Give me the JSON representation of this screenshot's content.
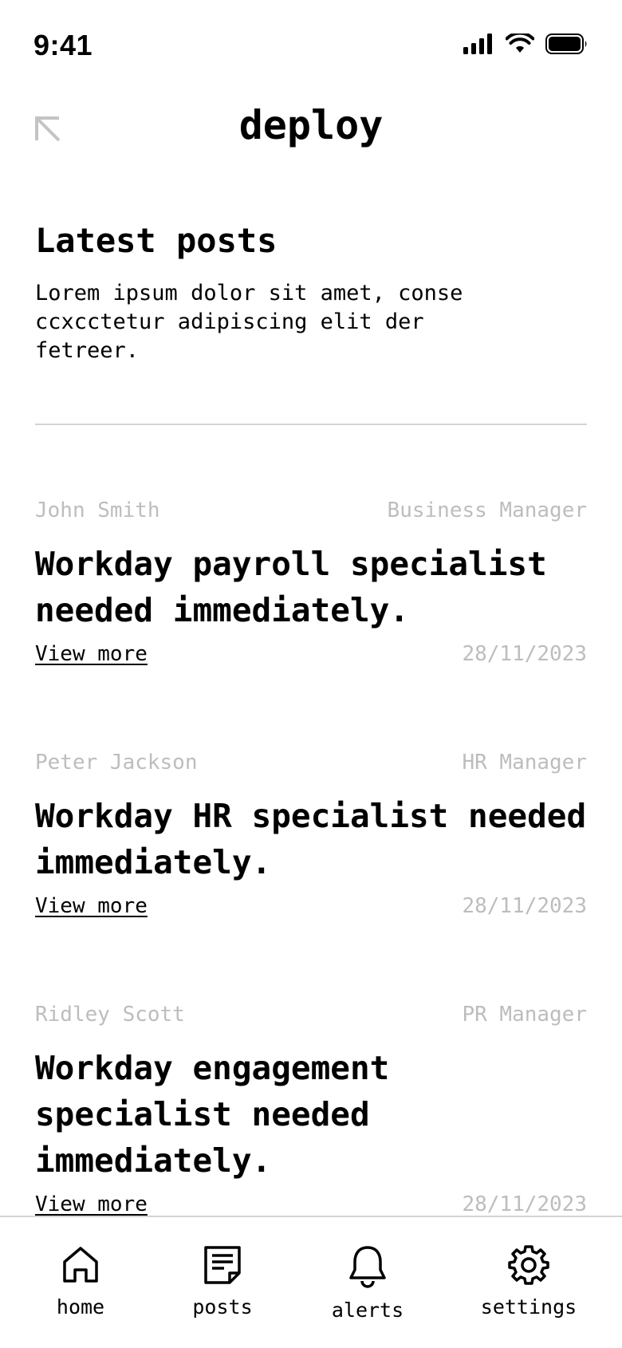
{
  "status_bar": {
    "time": "9:41"
  },
  "header": {
    "title": "deploy"
  },
  "intro": {
    "title": "Latest posts",
    "description": "Lorem ipsum dolor sit amet, conse ccxcctetur adipiscing elit der fetreer."
  },
  "posts": [
    {
      "author": "John Smith",
      "role": "Business Manager",
      "title": "Workday payroll specialist needed immediately.",
      "link": "View more",
      "date": "28/11/2023"
    },
    {
      "author": "Peter Jackson",
      "role": "HR Manager",
      "title": "Workday HR specialist needed immediately.",
      "link": "View more",
      "date": "28/11/2023"
    },
    {
      "author": "Ridley Scott",
      "role": "PR Manager",
      "title": "Workday engagement specialist needed immediately.",
      "link": "View more",
      "date": "28/11/2023"
    }
  ],
  "tabs": [
    {
      "label": "home",
      "icon": "home-icon"
    },
    {
      "label": "posts",
      "icon": "posts-icon"
    },
    {
      "label": "alerts",
      "icon": "bell-icon"
    },
    {
      "label": "settings",
      "icon": "gear-icon"
    }
  ],
  "colors": {
    "text": "#000000",
    "muted": "#bdbdbd",
    "divider": "#d4d4d4",
    "back_icon": "#c4c4c4"
  }
}
